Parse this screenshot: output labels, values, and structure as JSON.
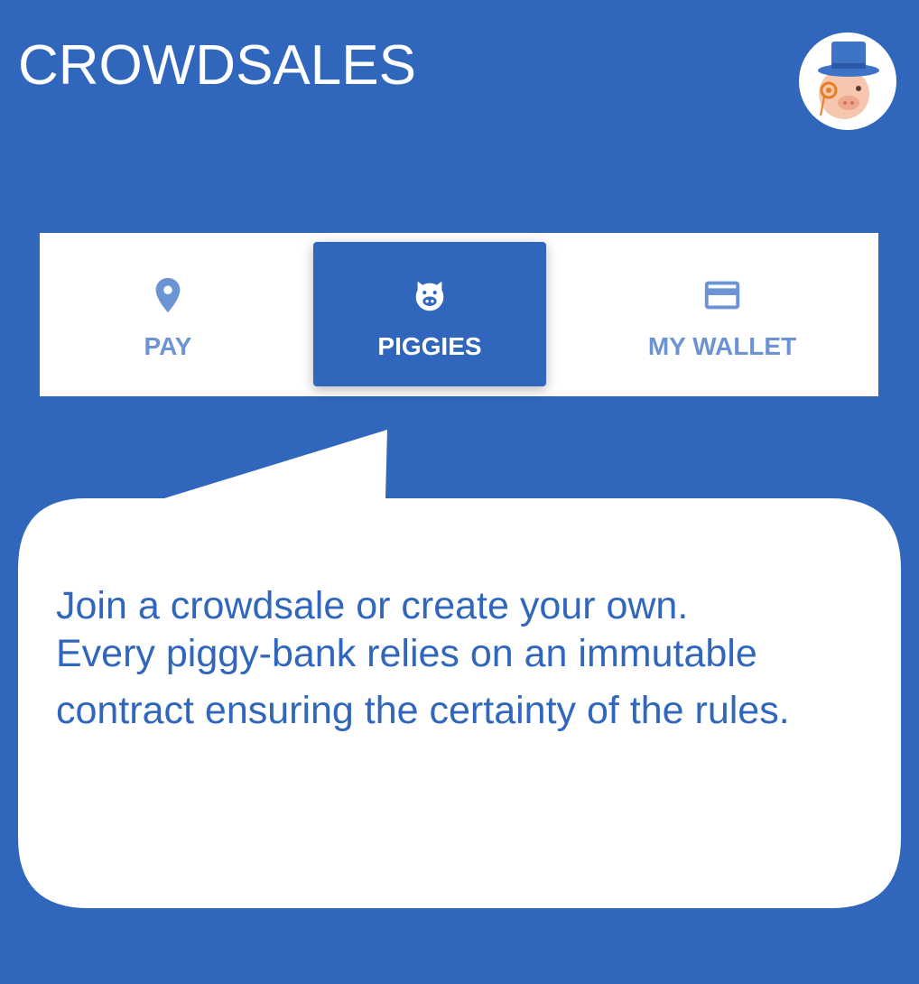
{
  "header": {
    "title": "CROWDSALES",
    "avatar_icon": "top-hat-pig-mascot-icon"
  },
  "tabs": [
    {
      "label": "PAY",
      "icon": "location-pin-icon",
      "selected": false
    },
    {
      "label": "PIGGIES",
      "icon": "pig-face-icon",
      "selected": true
    },
    {
      "label": "MY WALLET",
      "icon": "credit-card-icon",
      "selected": false
    }
  ],
  "callout": {
    "lines": [
      "Join a crowdsale or create your own.",
      "Every piggy-bank relies on an immutable",
      "contract ensuring the certainty of the rules."
    ]
  },
  "colors": {
    "background": "#3066BC",
    "tab_inactive": "#6C93D4",
    "surface": "#FFFFFF",
    "mascot_hat": "#3F73C6",
    "mascot_skin": "#F6C7AE",
    "monocle": "#E67E22"
  }
}
